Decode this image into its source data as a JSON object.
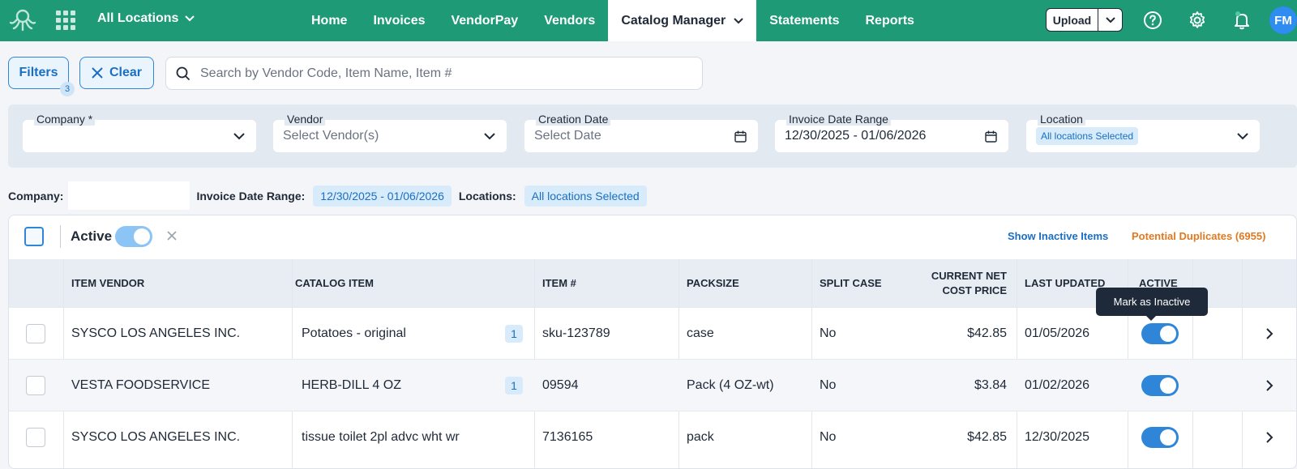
{
  "topnav": {
    "location_selector": "All Locations",
    "items": [
      {
        "label": "Home"
      },
      {
        "label": "Invoices"
      },
      {
        "label": "VendorPay"
      },
      {
        "label": "Vendors"
      },
      {
        "label": "Catalog Manager",
        "active": true
      },
      {
        "label": "Statements"
      },
      {
        "label": "Reports"
      }
    ],
    "upload_label": "Upload",
    "avatar_initials": "FM",
    "brand_color": "#1e9a76",
    "icons": [
      "octopus-logo-icon",
      "apps-grid-icon",
      "help-icon",
      "gear-icon",
      "bell-icon"
    ]
  },
  "filter_bar": {
    "filters_label": "Filters",
    "filters_count": "3",
    "clear_label": "Clear",
    "search_placeholder": "Search by Vendor Code, Item Name, Item #"
  },
  "filters": {
    "company": {
      "label": "Company *",
      "value": ""
    },
    "vendor": {
      "label": "Vendor",
      "placeholder": "Select Vendor(s)"
    },
    "creation_date": {
      "label": "Creation Date",
      "placeholder": "Select Date"
    },
    "invoice_date_range": {
      "label": "Invoice Date Range",
      "value": "12/30/2025 - 01/06/2026"
    },
    "location": {
      "label": "Location",
      "chip": "All locations Selected"
    }
  },
  "summary": {
    "company_label": "Company:",
    "company_value": "",
    "date_label": "Invoice Date Range:",
    "date_value": "12/30/2025 - 01/06/2026",
    "locations_label": "Locations:",
    "locations_value": "All locations Selected"
  },
  "toolbar": {
    "active_label": "Active",
    "active_on": true,
    "show_inactive_label": "Show Inactive Items",
    "duplicates_label": "Potential Duplicates (6955)",
    "duplicates_color": "#e07a22"
  },
  "table": {
    "headers": {
      "vendor": "ITEM VENDOR",
      "catalog_item": "CATALOG ITEM",
      "item_no": "ITEM #",
      "packsize": "PACKSIZE",
      "split_case": "SPLIT CASE",
      "price_line1": "CURRENT NET",
      "price_line2": "COST PRICE",
      "last_updated": "LAST UPDATED",
      "active": "ACTIVE"
    },
    "rows": [
      {
        "vendor": "SYSCO LOS ANGELES INC.",
        "catalog_item": "Potatoes - original",
        "badge": "1",
        "item_no": "sku-123789",
        "packsize": "case",
        "split_case": "No",
        "price": "$42.85",
        "last_updated": "01/05/2026",
        "active": true
      },
      {
        "vendor": "VESTA FOODSERVICE",
        "catalog_item": "HERB-DILL 4 OZ",
        "badge": "1",
        "item_no": "09594",
        "packsize": "Pack (4 OZ-wt)",
        "split_case": "No",
        "price": "$3.84",
        "last_updated": "01/02/2026",
        "active": true
      },
      {
        "vendor": "SYSCO LOS ANGELES INC.",
        "catalog_item": "tissue toilet 2pl advc wht wr",
        "badge": "",
        "item_no": "7136165",
        "packsize": "pack",
        "split_case": "No",
        "price": "$42.85",
        "last_updated": "12/30/2025",
        "active": true
      }
    ]
  },
  "tooltip": "Mark as Inactive"
}
